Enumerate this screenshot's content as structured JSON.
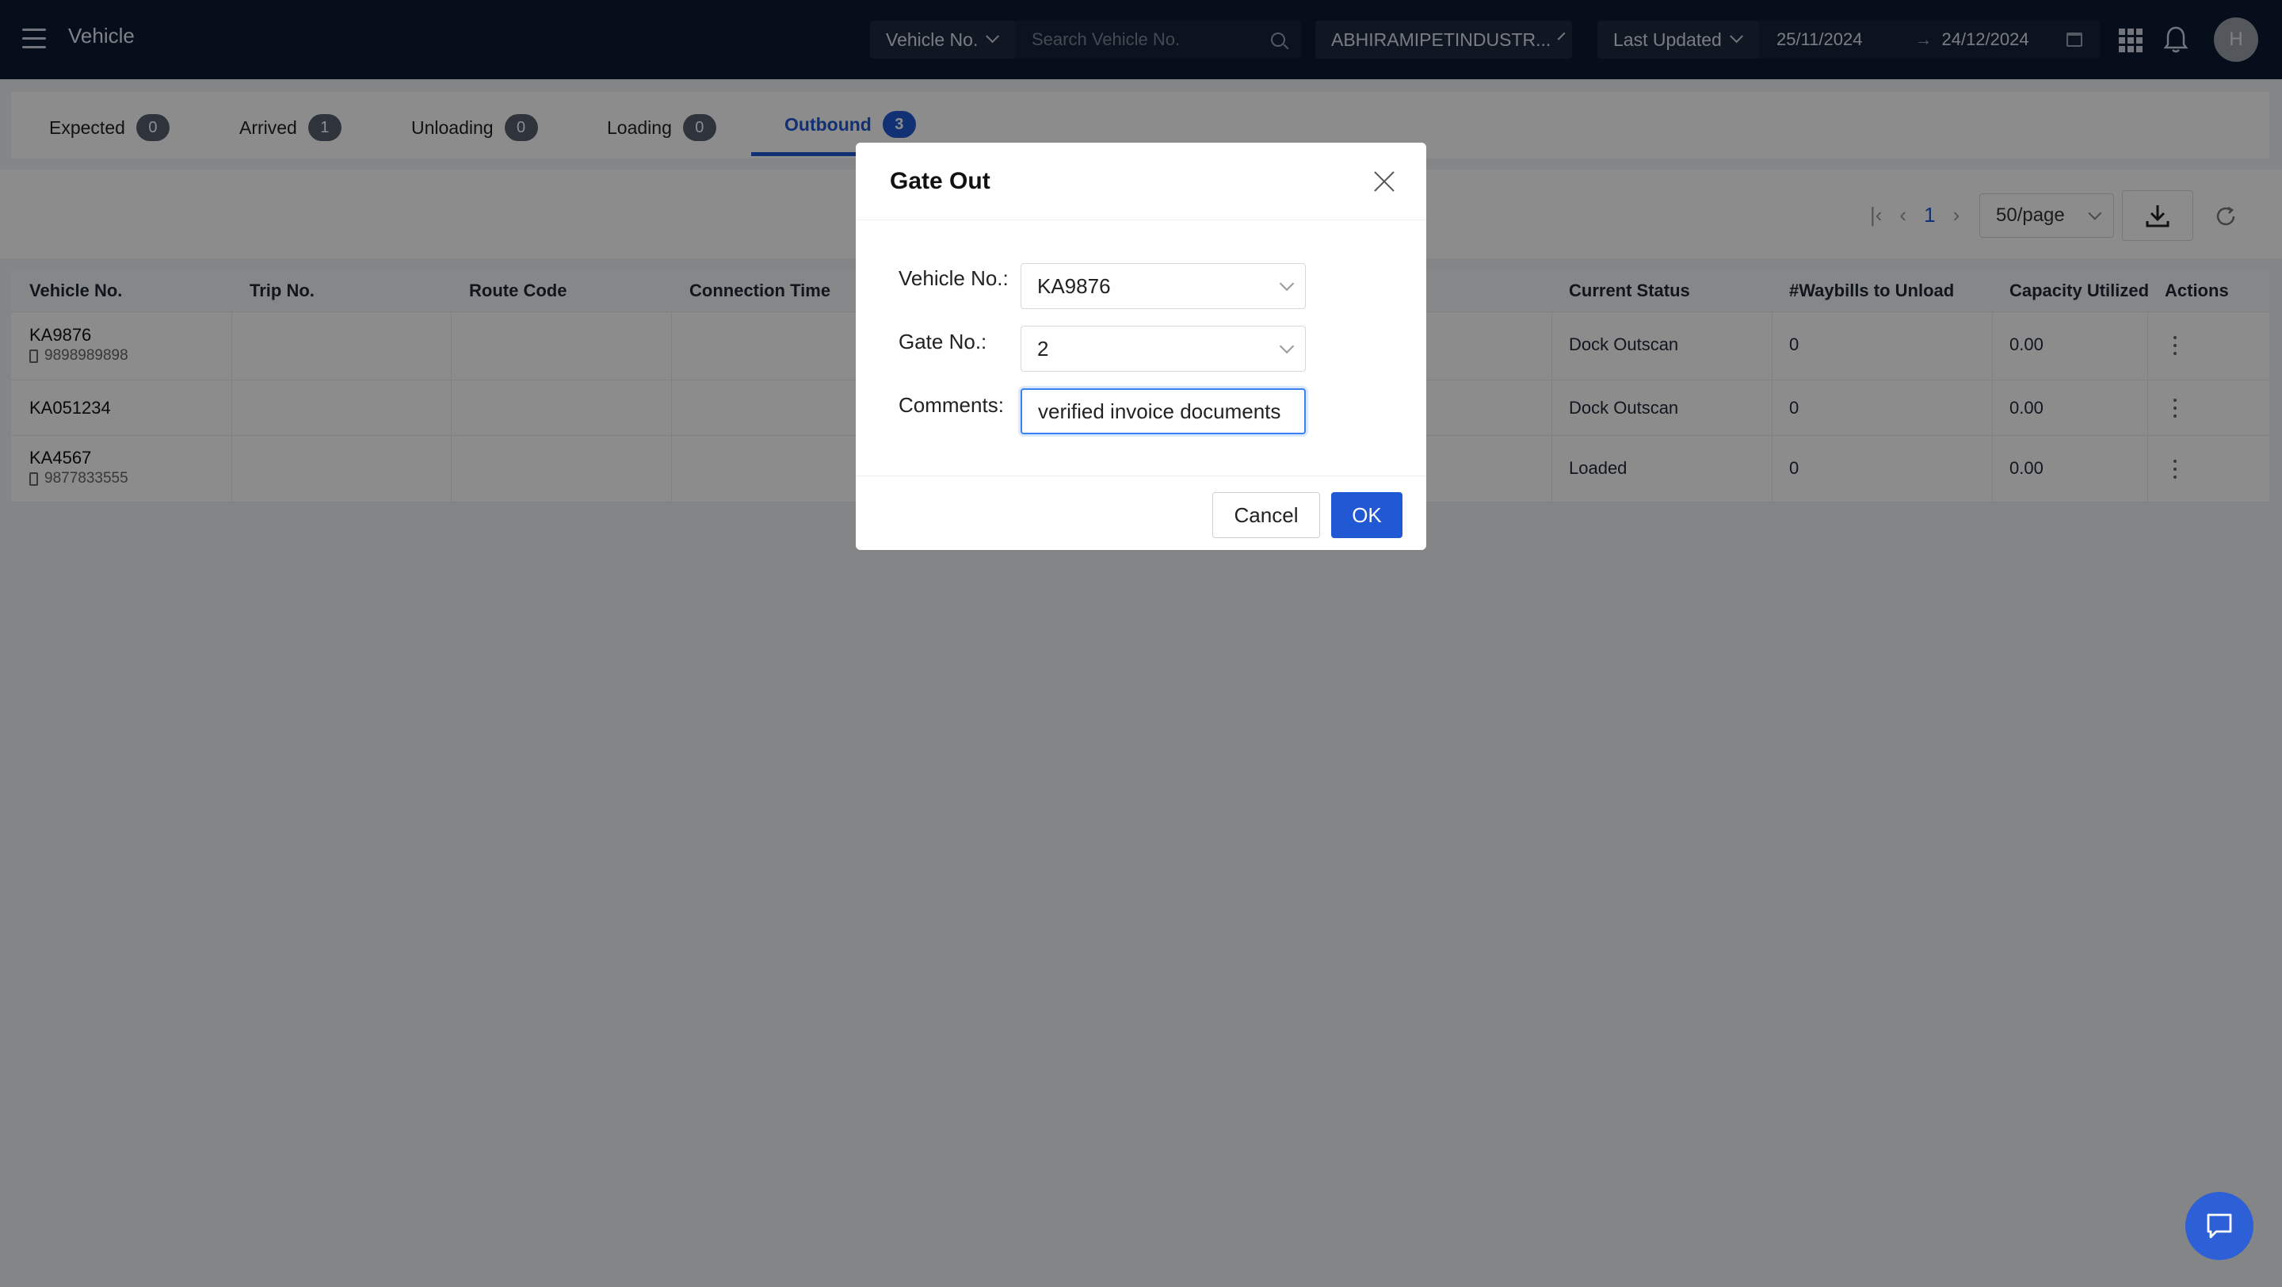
{
  "header": {
    "title": "Vehicle",
    "filter_field": "Vehicle No.",
    "search_placeholder": "Search Vehicle No.",
    "location": "ABHIRAMIPETINDUSTR...",
    "date_field": "Last Updated",
    "date_from": "25/11/2024",
    "date_to": "24/12/2024",
    "date_arrow": "→",
    "avatar_initial": "H"
  },
  "tabs": [
    {
      "label": "Expected",
      "count": "0"
    },
    {
      "label": "Arrived",
      "count": "1"
    },
    {
      "label": "Unloading",
      "count": "0"
    },
    {
      "label": "Loading",
      "count": "0"
    },
    {
      "label": "Outbound",
      "count": "3",
      "active": true
    }
  ],
  "pager": {
    "current_page": "1",
    "page_size": "50/page"
  },
  "table": {
    "columns": [
      "Vehicle No.",
      "Trip No.",
      "Route Code",
      "Connection Time",
      "Current Status",
      "#Waybills to Unload",
      "Capacity Utilized",
      "Actions"
    ],
    "rows": [
      {
        "vehicle": "KA9876",
        "phone": "9898989898",
        "status": "Dock Outscan",
        "waybills": "0",
        "capacity": "0.00"
      },
      {
        "vehicle": "KA051234",
        "phone": "",
        "status": "Dock Outscan",
        "waybills": "0",
        "capacity": "0.00"
      },
      {
        "vehicle": "KA4567",
        "phone": "9877833555",
        "status": "Loaded",
        "waybills": "0",
        "capacity": "0.00"
      }
    ]
  },
  "modal": {
    "title": "Gate Out",
    "vehicle_label": "Vehicle No.:",
    "vehicle_value": "KA9876",
    "gate_label": "Gate No.:",
    "gate_value": "2",
    "comments_label": "Comments:",
    "comments_value": "verified invoice documents",
    "cancel_label": "Cancel",
    "ok_label": "OK"
  },
  "colors": {
    "topbar": "#0c1a33",
    "accent": "#2158d4",
    "badge": "#56606e"
  },
  "icons": [
    "menu-icon",
    "chevron-down-icon",
    "search-icon",
    "calendar-icon",
    "apps-grid-icon",
    "bell-icon",
    "first-page-icon",
    "prev-page-icon",
    "next-page-icon",
    "download-icon",
    "refresh-icon",
    "phone-icon",
    "more-vertical-icon",
    "close-icon",
    "chat-icon"
  ]
}
